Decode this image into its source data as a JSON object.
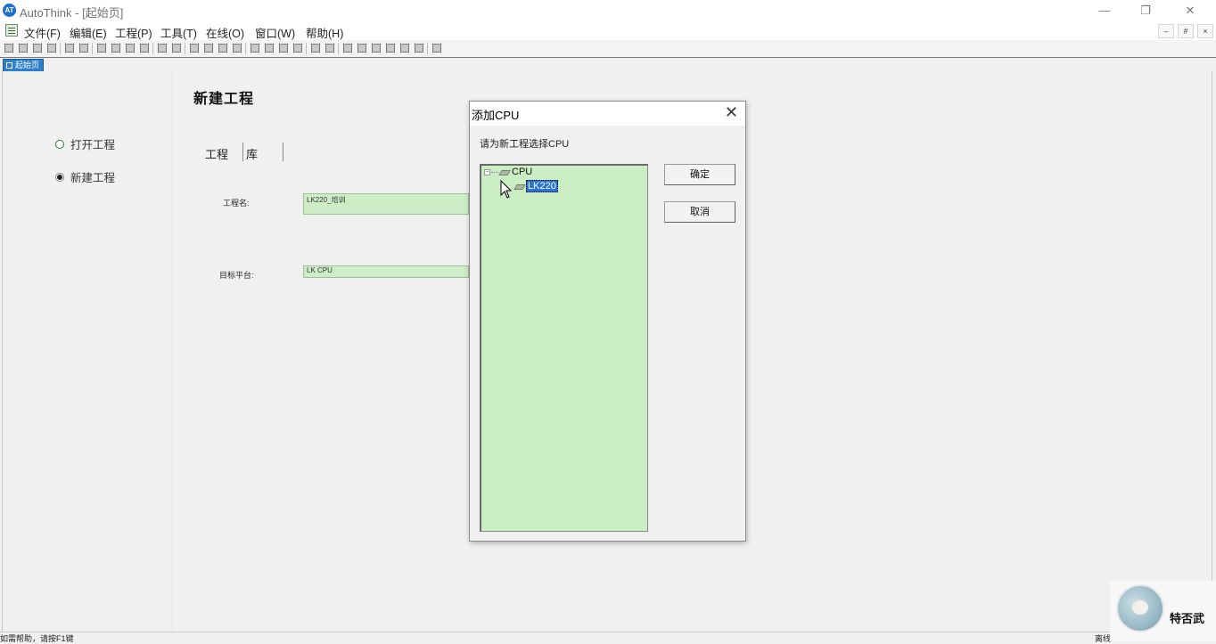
{
  "window": {
    "app_title": "AutoThink - [起始页]",
    "app_icon_letters": "AT",
    "controls": {
      "minimize": "—",
      "restore": "❐",
      "close": "✕"
    }
  },
  "menubar": {
    "items": [
      "文件(F)",
      "编辑(E)",
      "工程(P)",
      "工具(T)",
      "在线(O)",
      "窗口(W)",
      "帮助(H)"
    ],
    "mdi_controls": [
      "–",
      "#",
      "×"
    ]
  },
  "toolbar": {
    "icon_count": 29
  },
  "doc_tabs": [
    {
      "label": "起始页",
      "active": true
    }
  ],
  "start_page": {
    "left_nav": [
      {
        "label": "打开工程",
        "selected": false
      },
      {
        "label": "新建工程",
        "selected": true
      }
    ],
    "title": "新建工程",
    "tabs": [
      "工程",
      "库"
    ],
    "fields": {
      "project_name": {
        "label": "工程名:",
        "value": "LK220_培训"
      },
      "target_platform": {
        "label": "目标平台:",
        "value": "LK CPU"
      }
    }
  },
  "dialog": {
    "title": "添加CPU",
    "close_icon": "✕",
    "prompt": "请为新工程选择CPU",
    "tree": {
      "root": {
        "label": "CPU",
        "expander": "⊟"
      },
      "children": [
        {
          "label": "LK220",
          "selected": true
        }
      ]
    },
    "buttons": {
      "ok": "确定",
      "cancel": "取消"
    }
  },
  "statusbar": {
    "left": "如需帮助，请按F1键",
    "right": "离线"
  },
  "watermark": {
    "text": "特否武"
  }
}
